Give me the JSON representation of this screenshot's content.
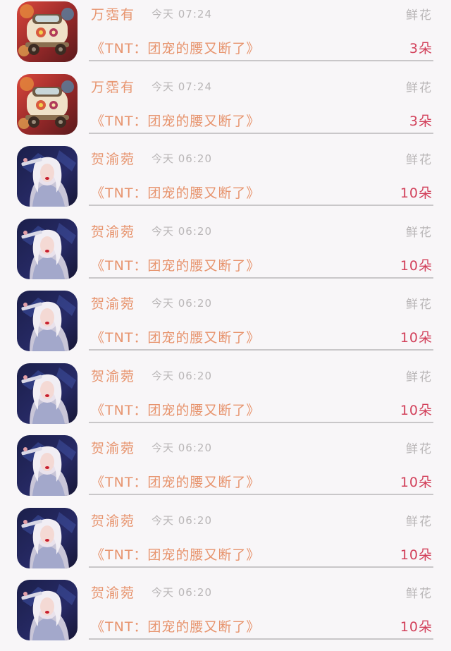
{
  "records": [
    {
      "avatar": "car-avatar",
      "name": "万霑有",
      "time": "今天  07:24",
      "gift_type": "鲜花",
      "work_title": "《TNT：团宠的腰又断了》",
      "count": "3朵"
    },
    {
      "avatar": "car-avatar",
      "name": "万霑有",
      "time": "今天  07:24",
      "gift_type": "鲜花",
      "work_title": "《TNT：团宠的腰又断了》",
      "count": "3朵"
    },
    {
      "avatar": "girl-avatar",
      "name": "贺渝菀",
      "time": "今天  06:20",
      "gift_type": "鲜花",
      "work_title": "《TNT：团宠的腰又断了》",
      "count": "10朵"
    },
    {
      "avatar": "girl-avatar",
      "name": "贺渝菀",
      "time": "今天  06:20",
      "gift_type": "鲜花",
      "work_title": "《TNT：团宠的腰又断了》",
      "count": "10朵"
    },
    {
      "avatar": "girl-avatar",
      "name": "贺渝菀",
      "time": "今天  06:20",
      "gift_type": "鲜花",
      "work_title": "《TNT：团宠的腰又断了》",
      "count": "10朵"
    },
    {
      "avatar": "girl-avatar",
      "name": "贺渝菀",
      "time": "今天  06:20",
      "gift_type": "鲜花",
      "work_title": "《TNT：团宠的腰又断了》",
      "count": "10朵"
    },
    {
      "avatar": "girl-avatar",
      "name": "贺渝菀",
      "time": "今天  06:20",
      "gift_type": "鲜花",
      "work_title": "《TNT：团宠的腰又断了》",
      "count": "10朵"
    },
    {
      "avatar": "girl-avatar",
      "name": "贺渝菀",
      "time": "今天  06:20",
      "gift_type": "鲜花",
      "work_title": "《TNT：团宠的腰又断了》",
      "count": "10朵"
    },
    {
      "avatar": "girl-avatar",
      "name": "贺渝菀",
      "time": "今天  06:20",
      "gift_type": "鲜花",
      "work_title": "《TNT：团宠的腰又断了》",
      "count": "10朵"
    }
  ]
}
